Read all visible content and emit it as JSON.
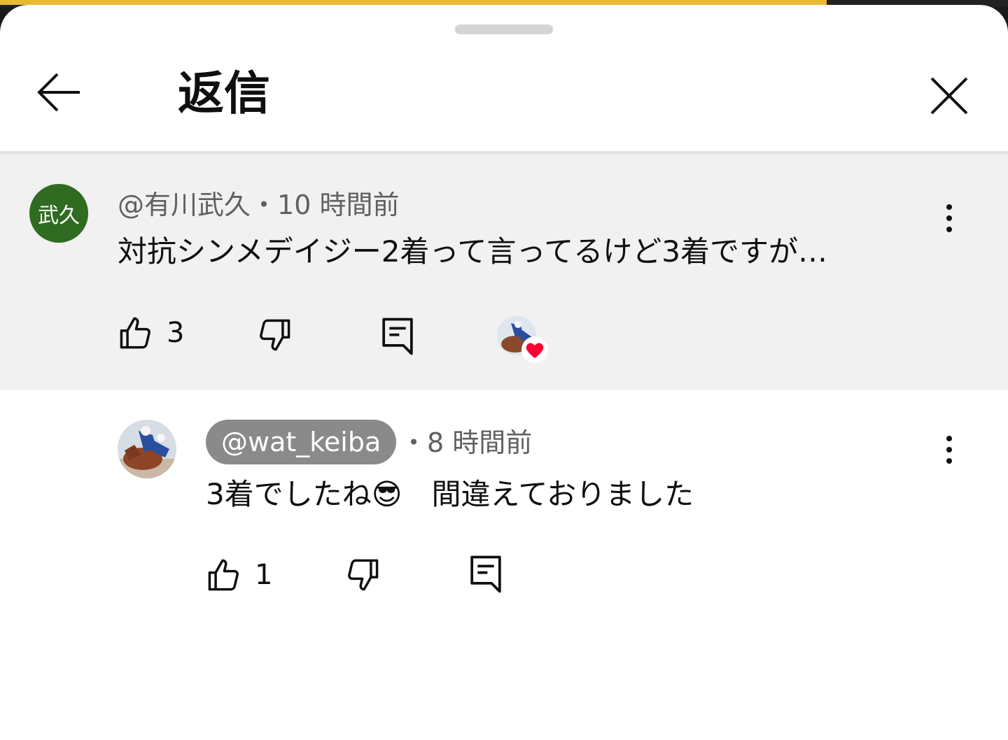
{
  "header": {
    "title": "返信"
  },
  "parent_comment": {
    "avatar_text": "武久",
    "author": "@有川武久",
    "separator": "・",
    "time": "10 時間前",
    "text": "対抗シンメデイジー2着って言ってるけど3着ですが…",
    "likes": "3",
    "creator_heart": true
  },
  "reply": {
    "author": "@wat_keiba",
    "separator": "・",
    "time": "8 時間前",
    "text": "3着でしたね😎　間違えておりました",
    "likes": "1"
  },
  "colors": {
    "accent_progress": "#e8b934",
    "avatar_bg": "#2f6b20",
    "heart": "#ff0033",
    "handle_pill": "#8a8a8a"
  },
  "progress_fraction": 0.82
}
